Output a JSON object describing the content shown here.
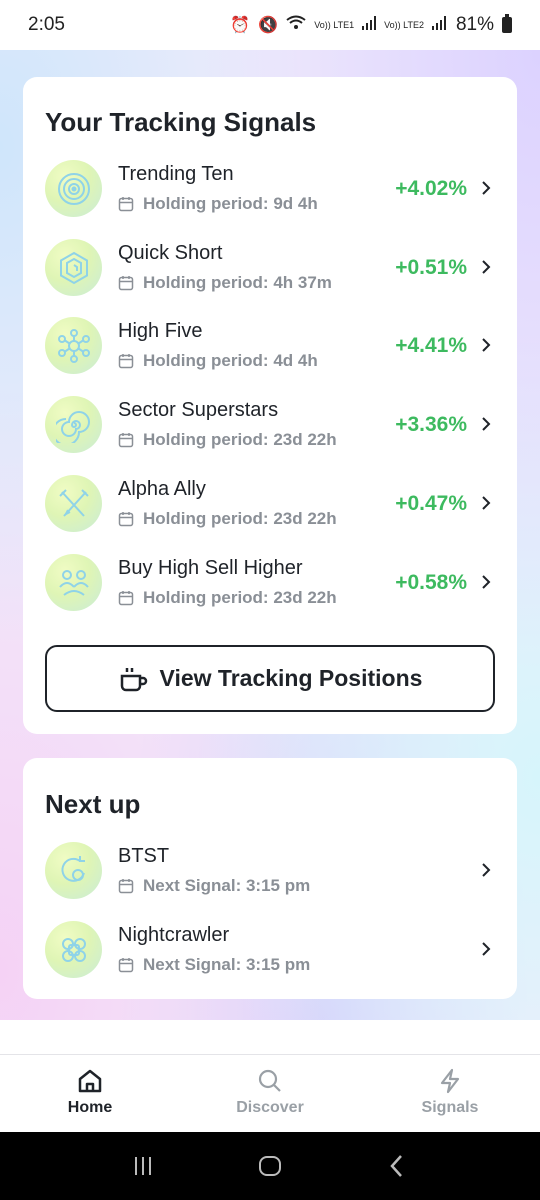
{
  "status": {
    "time": "2:05",
    "lte1": "Vo)) LTE1",
    "lte2": "Vo)) LTE2",
    "battery": "81%"
  },
  "tracking": {
    "title": "Your Tracking Signals",
    "items": [
      {
        "name": "Trending Ten",
        "sub": "Holding period: 9d 4h",
        "pct": "+4.02%",
        "icon": "target-rings-icon"
      },
      {
        "name": "Quick Short",
        "sub": "Holding period: 4h 37m",
        "pct": "+0.51%",
        "icon": "hexagon-spiral-icon"
      },
      {
        "name": "High Five",
        "sub": "Holding period: 4d 4h",
        "pct": "+4.41%",
        "icon": "molecule-icon"
      },
      {
        "name": "Sector Superstars",
        "sub": "Holding period: 23d 22h",
        "pct": "+3.36%",
        "icon": "spiral-icon"
      },
      {
        "name": "Alpha Ally",
        "sub": "Holding period: 23d 22h",
        "pct": "+0.47%",
        "icon": "crossed-swords-icon"
      },
      {
        "name": "Buy High Sell Higher",
        "sub": "Holding period: 23d 22h",
        "pct": "+0.58%",
        "icon": "people-icon"
      }
    ],
    "button_label": "View Tracking Positions"
  },
  "next": {
    "title": "Next up",
    "items": [
      {
        "name": "BTST",
        "sub": "Next Signal: 3:15 pm",
        "icon": "refresh-circle-icon"
      },
      {
        "name": "Nightcrawler",
        "sub": "Next Signal: 3:15 pm",
        "icon": "knot-icon"
      }
    ]
  },
  "nav": {
    "home": "Home",
    "discover": "Discover",
    "signals": "Signals"
  },
  "colors": {
    "positive": "#3dba5f",
    "icon_stroke": "#8fd3e8",
    "avatar_bg": "#dff5b5"
  }
}
